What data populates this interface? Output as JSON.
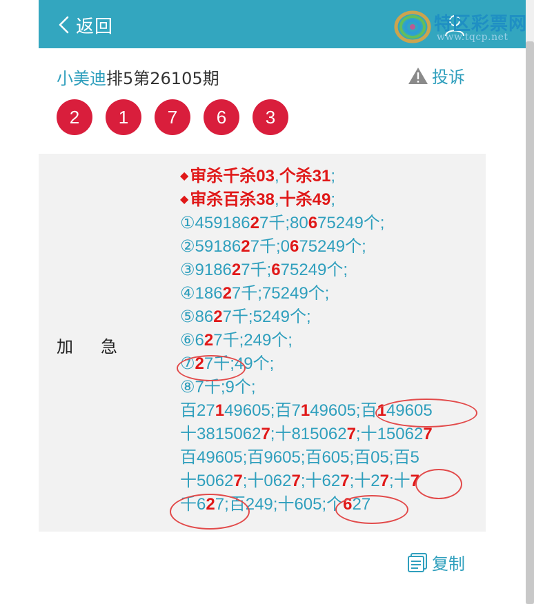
{
  "header": {
    "back_label": "返回"
  },
  "logo": {
    "brand": "特区彩票网",
    "url": "www.tqcp.net"
  },
  "title": {
    "author": "小美迪",
    "rest": "排5第26105期"
  },
  "complain_label": "投诉",
  "balls": [
    "2",
    "1",
    "7",
    "6",
    "3"
  ],
  "category": {
    "c1": "加",
    "c2": "急"
  },
  "lines": {
    "l1": {
      "a": "审杀千杀03",
      "b": ",",
      "c": "个杀31",
      "d": ";"
    },
    "l2": {
      "a": "审杀百杀38",
      "b": ",",
      "c": "十杀49",
      "d": ";"
    },
    "l3": {
      "a": "①459186",
      "b": "2",
      "c": "7千;80",
      "d": "6",
      "e": "75249个;"
    },
    "l4": {
      "a": "②59186",
      "b": "2",
      "c": "7千;0",
      "d": "6",
      "e": "75249个;"
    },
    "l5": {
      "a": "③9186",
      "b": "2",
      "c": "7千;",
      "d": "6",
      "e": "75249个;"
    },
    "l6": {
      "a": "④186",
      "b": "2",
      "c": "7千;75249个;"
    },
    "l7": {
      "a": "⑤86",
      "b": "2",
      "c": "7千;5249个;"
    },
    "l8": {
      "a": "⑥6",
      "b": "2",
      "c": "7千;249个;"
    },
    "l9": {
      "a": "⑦",
      "b": "2",
      "c": "7千;49个;"
    },
    "l10": {
      "a": "⑧7千;9个;"
    },
    "l11": {
      "a": "百27",
      "b": "1",
      "c": "49605;百7",
      "d": "1",
      "e": "49605;百",
      "f": "1",
      "g": "49605"
    },
    "l12": {
      "a": "十3815062",
      "b": "7",
      "c": ";十815062",
      "d": "7",
      "e": ";十15062",
      "f": "7"
    },
    "l13": {
      "a": "百49605;百9605;百605;百05;百5"
    },
    "l14": {
      "a": "十5062",
      "b": "7",
      "c": ";十062",
      "d": "7",
      "e": ";十62",
      "f": "7",
      "g": ";十2",
      "h": "7",
      "i": ";十",
      "j": "7"
    },
    "l15": {
      "a": "千6",
      "b": "2",
      "c": "7;百249;十605;个",
      "d": "6",
      "e": "27"
    }
  },
  "copy_label": "复制",
  "colors": {
    "header": "#33a6bf",
    "accent": "#2f9fbd",
    "ball": "#d91e3c",
    "highlight": "#e01818"
  }
}
